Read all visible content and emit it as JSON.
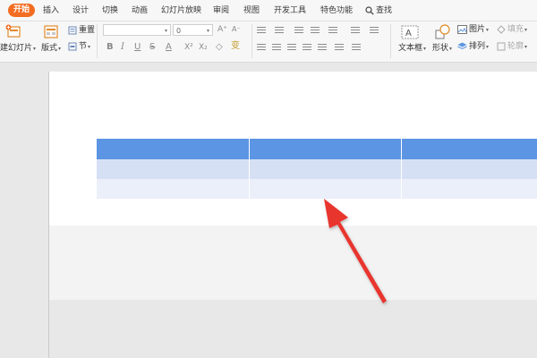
{
  "menu": {
    "tabs": [
      {
        "id": "home",
        "label": "开始"
      },
      {
        "id": "insert",
        "label": "插入"
      },
      {
        "id": "design",
        "label": "设计"
      },
      {
        "id": "transition",
        "label": "切换"
      },
      {
        "id": "animation",
        "label": "动画"
      },
      {
        "id": "slideshow",
        "label": "幻灯片放映"
      },
      {
        "id": "review",
        "label": "审阅"
      },
      {
        "id": "view",
        "label": "视图"
      },
      {
        "id": "developer",
        "label": "开发工具"
      },
      {
        "id": "special",
        "label": "特色功能"
      }
    ],
    "search_label": "查找",
    "accent_color": "#f36c21"
  },
  "ribbon": {
    "new_slide_label": "建幻灯片",
    "layout_label": "版式",
    "reset_label": "重置",
    "section_label": "节",
    "font_name_value": "",
    "font_size_value": "0",
    "textbox_label": "文本框",
    "shape_label": "形状",
    "picture_label": "图片",
    "arrange_label": "排列",
    "fill_label": "填充",
    "outline_label": "轮廓"
  },
  "slide": {
    "table": {
      "columns": 3,
      "rows": [
        {
          "type": "header",
          "cells": [
            "",
            "",
            ""
          ]
        },
        {
          "type": "band1",
          "cells": [
            "",
            "",
            ""
          ]
        },
        {
          "type": "band2",
          "cells": [
            "",
            "",
            ""
          ]
        }
      ],
      "header_color": "#5c95e3",
      "band1_color": "#d6e0f5",
      "band2_color": "#eaeff9"
    },
    "annotation": {
      "type": "arrow",
      "color": "#e8342f"
    }
  }
}
